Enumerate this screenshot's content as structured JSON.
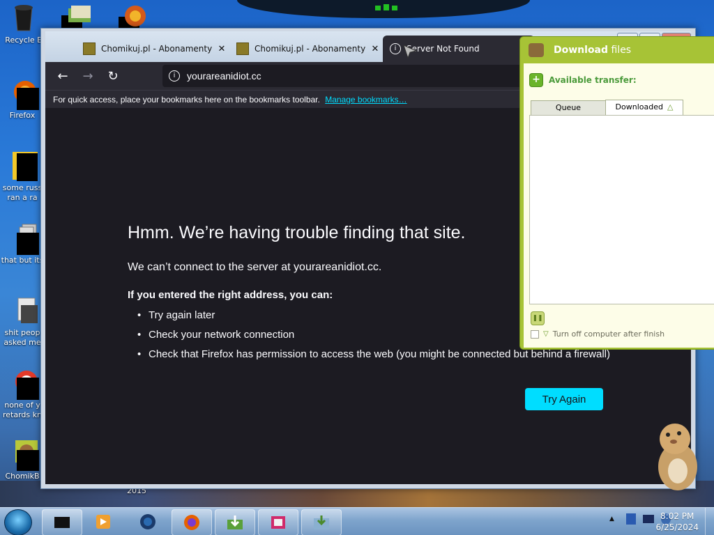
{
  "desktop": {
    "icons": [
      {
        "label": "Recycle B"
      },
      {
        "label": "Firefox"
      },
      {
        "label": "some russ ran a ra"
      },
      {
        "label": "that but its"
      },
      {
        "label": "shit peop asked me"
      },
      {
        "label": "none of y retards kn"
      },
      {
        "label": "ChomikB"
      }
    ],
    "wallpaper_text": "2015"
  },
  "browser": {
    "tabs": [
      {
        "title": "Chomikuj.pl - Abonamenty i D",
        "close": "✕"
      },
      {
        "title": "Chomikuj.pl - Abonamenty i D",
        "close": "✕"
      },
      {
        "title": "Server Not Found",
        "active": true
      }
    ],
    "nav": {
      "back": "←",
      "forward": "→",
      "reload": "↻"
    },
    "url": "yourareanidiot.cc",
    "bookmarks_bar": {
      "text": "For quick access, place your bookmarks here on the bookmarks toolbar.",
      "link": "Manage bookmarks…"
    },
    "error": {
      "title": "Hmm. We’re having trouble finding that site.",
      "subtitle": "We can’t connect to the server at yourareanidiot.cc.",
      "if_text": "If you entered the right address, you can:",
      "suggestions": [
        "Try again later",
        "Check your network connection",
        "Check that Firefox has permission to access the web (you might be connected but behind a firewall)"
      ],
      "try_again": "Try Again"
    }
  },
  "download_panel": {
    "title_bold": "Download",
    "title_rest": " files",
    "available_label": "Available transfer:",
    "tabs": [
      "Queue",
      "Downloaded"
    ],
    "active_tab": "Downloaded",
    "shutdown_label": "Turn off computer after finish"
  },
  "taskbar": {
    "time": "8:02 PM",
    "date": "6/25/2024"
  },
  "colors": {
    "firefox_bg": "#1c1b22",
    "firefox_chrome": "#2b2a33",
    "accent": "#00ddff",
    "panel_green": "#a7c336"
  }
}
